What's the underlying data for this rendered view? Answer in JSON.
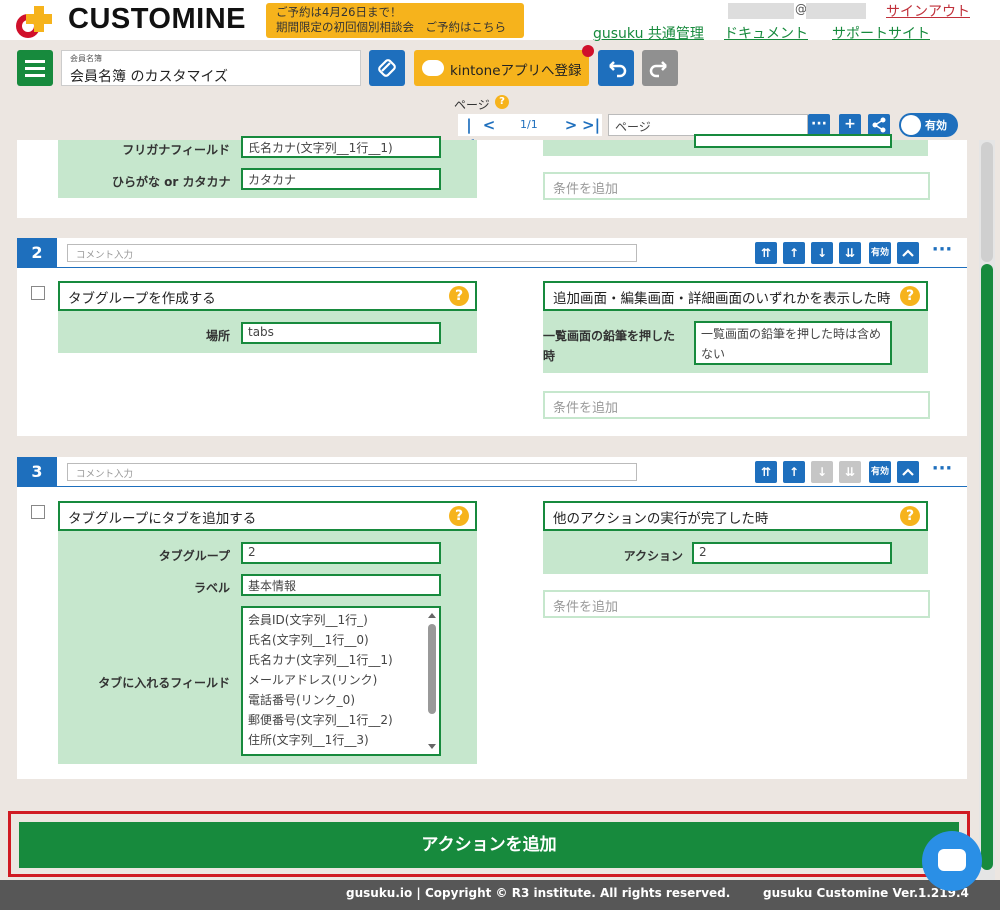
{
  "header": {
    "logo_text": "CUSTOMINE",
    "promo_line1": "ご予約は4月26日まで！",
    "promo_line2": "期間限定の初回個別相談会　ご予約はこちら",
    "at_sign": "@",
    "signout": "サインアウト",
    "links": [
      "gusuku 共通管理",
      "ドキュメント",
      "サポートサイト"
    ]
  },
  "toolbar": {
    "app_caption": "会員名簿",
    "app_title": "会員名簿 のカスタマイズ",
    "kintone_label": "kintoneアプリへ登録"
  },
  "pager": {
    "label": "ページ",
    "help": "?",
    "current": "1/1",
    "page_select": "ページ",
    "enable_label": "有効"
  },
  "action1": {
    "fields": [
      {
        "label": "フリガナフィールド",
        "value": "氏名カナ(文字列__1行__1)"
      },
      {
        "label": "ひらがな or カタカナ",
        "value": "カタカナ"
      }
    ],
    "add_condition": "条件を追加"
  },
  "action2": {
    "number": "2",
    "comment_placeholder": "コメント入力",
    "title": "タブグループを作成する",
    "fields": [
      {
        "label": "場所",
        "value": "tabs"
      }
    ],
    "condition_title": "追加画面・編集画面・詳細画面のいずれかを表示した時",
    "condition_fields": [
      {
        "label": "一覧画面の鉛筆を押した時",
        "value": "一覧画面の鉛筆を押した時は含めない"
      }
    ],
    "add_condition": "条件を追加",
    "effective": "有効"
  },
  "action3": {
    "number": "3",
    "comment_placeholder": "コメント入力",
    "title": "タブグループにタブを追加する",
    "fields": [
      {
        "label": "タブグループ",
        "value": "2"
      },
      {
        "label": "ラベル",
        "value": "基本情報"
      },
      {
        "label": "タブに入れるフィールド"
      }
    ],
    "list_items": [
      "会員ID(文字列__1行_)",
      "氏名(文字列__1行__0)",
      "氏名カナ(文字列__1行__1)",
      "メールアドレス(リンク)",
      "電話番号(リンク_0)",
      "郵便番号(文字列__1行__2)",
      "住所(文字列__1行__3)"
    ],
    "condition_title": "他のアクションの実行が完了した時",
    "condition_fields": [
      {
        "label": "アクション",
        "value": "2"
      }
    ],
    "add_condition": "条件を追加",
    "effective": "有効"
  },
  "add_action": "アクションを追加",
  "footer": {
    "copyright": "gusuku.io | Copyright © R3 institute. All rights reserved.",
    "version": "gusuku Customine Ver.1.219.4"
  },
  "colors": {
    "brand_green": "#178a3d",
    "action_blue": "#1e6fbd",
    "accent_yellow": "#f6b31c",
    "highlight_red": "#d01a22"
  }
}
